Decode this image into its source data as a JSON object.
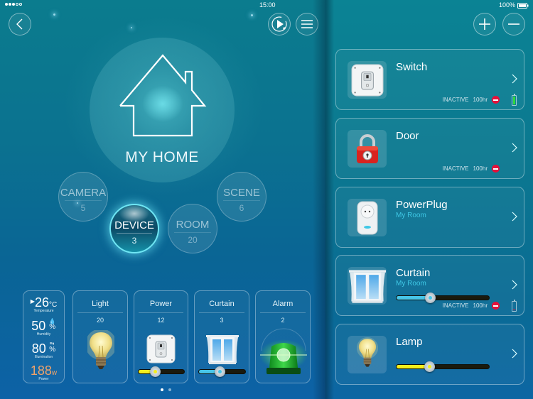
{
  "status_bar": {
    "signal_dots_filled": 3,
    "signal_dots_total": 5,
    "time": "15:00",
    "battery_text": "100%"
  },
  "header_left": {
    "back_icon": "chevron-left-icon",
    "play_icon": "play-schedule-icon",
    "menu_icon": "hamburger-menu-icon"
  },
  "header_right": {
    "add_icon": "plus-icon",
    "remove_icon": "minus-icon"
  },
  "home": {
    "label": "MY HOME",
    "icon": "house-outline-icon"
  },
  "nav_bubbles": [
    {
      "label": "CAMERA",
      "count": "5",
      "active": false
    },
    {
      "label": "DEVICE",
      "count": "3",
      "active": true
    },
    {
      "label": "ROOM",
      "count": "20",
      "active": false
    },
    {
      "label": "SCENE",
      "count": "6",
      "active": false
    }
  ],
  "environment": {
    "temperature": {
      "value": "26",
      "unit": "°C",
      "caption": "Temperature"
    },
    "humidity": {
      "value": "50",
      "unit": "%",
      "caption": "Humidity"
    },
    "illumination": {
      "value": "80",
      "unit": "%",
      "caption": "Illumination"
    },
    "power": {
      "value": "188",
      "unit": "w",
      "caption": "Power"
    },
    "power_color": "#f0a36a"
  },
  "category_tiles": [
    {
      "title": "Light",
      "count": "20",
      "icon": "light-bulb-icon"
    },
    {
      "title": "Power",
      "count": "12",
      "icon": "wall-switch-icon",
      "slider_percent": 36,
      "slider_color": "#f4ee1c"
    },
    {
      "title": "Curtain",
      "count": "3",
      "icon": "window-curtain-icon",
      "slider_percent": 45,
      "slider_color": "#47c6e8"
    },
    {
      "title": "Alarm",
      "count": "2",
      "icon": "green-siren-icon"
    }
  ],
  "pager": {
    "pages": 2,
    "current": 1
  },
  "devices": [
    {
      "name": "Switch",
      "room": "",
      "icon": "wall-switch-icon",
      "status": "INACTIVE",
      "hours": "100hr",
      "battery_percent": 100,
      "battery_color": "#2fd83c"
    },
    {
      "name": "Door",
      "room": "",
      "icon": "red-padlock-icon",
      "status": "INACTIVE",
      "hours": "100hr"
    },
    {
      "name": "PowerPlug",
      "room": "My Room",
      "icon": "power-plug-icon"
    },
    {
      "name": "Curtain",
      "room": "My Room",
      "icon": "window-curtain-icon",
      "slider_percent": 36,
      "slider_color": "#47c6e8",
      "status": "INACTIVE",
      "hours": "100hr",
      "battery_percent": 25,
      "battery_color": "#e4103a"
    },
    {
      "name": "Lamp",
      "room": "",
      "icon": "light-bulb-icon",
      "slider_percent": 35,
      "slider_color": "#f4ee1c"
    }
  ],
  "colors": {
    "accent_cyan": "#6fe6f4",
    "room_text": "#3fc8e6",
    "inactive_red": "#e4103a"
  }
}
